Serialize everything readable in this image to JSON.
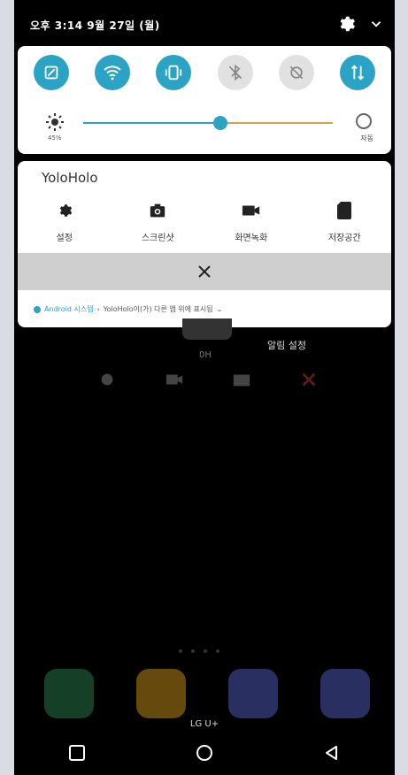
{
  "status_bar": {
    "time": "오후 3:14 9월 27일 (월)",
    "icons": [
      "gear-icon",
      "chevron-down-icon"
    ]
  },
  "quick_settings": {
    "toggles": [
      {
        "name": "screen-rotate-icon",
        "state": "on"
      },
      {
        "name": "wifi-icon",
        "state": "on"
      },
      {
        "name": "vibrate-icon",
        "state": "on"
      },
      {
        "name": "bluetooth-off-icon",
        "state": "off"
      },
      {
        "name": "auto-rotate-off-icon",
        "state": "off"
      },
      {
        "name": "mobile-data-icon",
        "state": "on"
      }
    ],
    "brightness": {
      "percent_label": "45%",
      "level": 0.55,
      "auto_label": "자동"
    },
    "accent": "#2aa3c4"
  },
  "notification": {
    "app_name": "YoloHolo",
    "actions": [
      {
        "label": "설정",
        "icon": "gear-icon"
      },
      {
        "label": "스크린샷",
        "icon": "camera-icon"
      },
      {
        "label": "화면녹화",
        "icon": "video-icon"
      },
      {
        "label": "저장공간",
        "icon": "sd-card-icon"
      }
    ],
    "dismiss_icon": "close-icon",
    "footer_system": "Android 시스템",
    "footer_text": "YoloHolo이(가) 다른 앱 위에 표시됨"
  },
  "background": {
    "timer": "0H",
    "alarm_label": "알림 설정",
    "carrier": "LG U+"
  },
  "nav": [
    "square-recents-icon",
    "circle-home-icon",
    "triangle-back-icon"
  ]
}
